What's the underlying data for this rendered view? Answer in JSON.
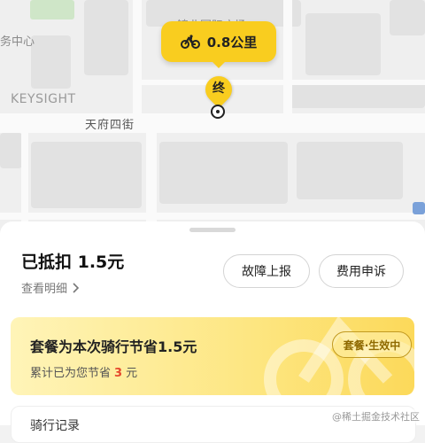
{
  "map": {
    "top_label": "锦业国际广场",
    "left_label": "务中心",
    "company_label": "KEYSIGHT",
    "street_name": "天府四街",
    "distance": "0.8公里",
    "end_marker": "终"
  },
  "trip": {
    "deducted": "已抵扣 1.5元",
    "detail_link": "查看明细",
    "report_button": "故障上报",
    "appeal_button": "费用申诉"
  },
  "promo": {
    "title": "套餐为本次骑行节省1.5元",
    "sub_prefix": "累计已为您节省",
    "sub_value": "3",
    "sub_suffix": "元",
    "badge": "套餐·生效中"
  },
  "next": {
    "partial": "骑行记录"
  },
  "watermark": "@稀土掘金技术社区",
  "colors": {
    "accent": "#f9cd1f",
    "highlight": "#e5482d"
  }
}
